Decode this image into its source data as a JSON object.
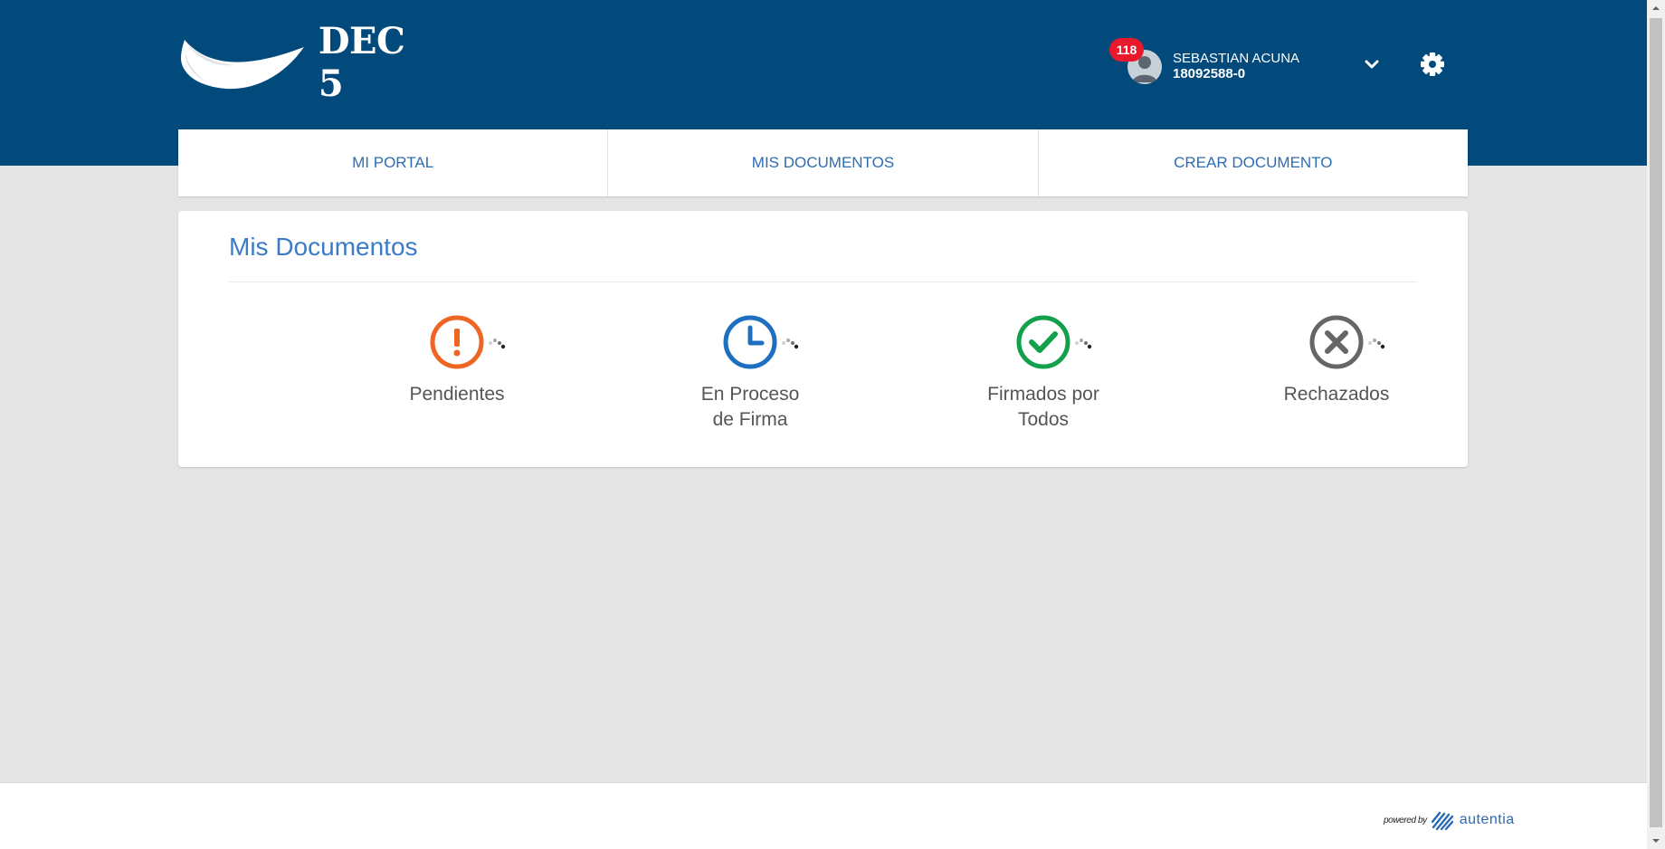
{
  "app": {
    "logo_text": "DEC 5"
  },
  "user": {
    "notifications": "118",
    "name": "SEBASTIAN ACUNA",
    "id": "18092588-0"
  },
  "nav": {
    "items": [
      {
        "label": "MI PORTAL"
      },
      {
        "label": "MIS DOCUMENTOS"
      },
      {
        "label": "CREAR DOCUMENTO"
      }
    ]
  },
  "panel": {
    "title": "Mis Documentos",
    "cards": [
      {
        "label": "Pendientes",
        "icon": "exclamation-circle-icon",
        "color": "#ee6524"
      },
      {
        "label": "En Proceso de Firma",
        "icon": "clock-icon",
        "color": "#1f6fc0"
      },
      {
        "label": "Firmados por Todos",
        "icon": "check-circle-icon",
        "color": "#12a04a"
      },
      {
        "label": "Rechazados",
        "icon": "x-circle-icon",
        "color": "#666666"
      }
    ]
  },
  "footer": {
    "powered_by": "powered by",
    "brand": "autentia"
  },
  "colors": {
    "header_bg": "#02497c",
    "accent": "#2d6cb5",
    "badge": "#e8192c"
  }
}
